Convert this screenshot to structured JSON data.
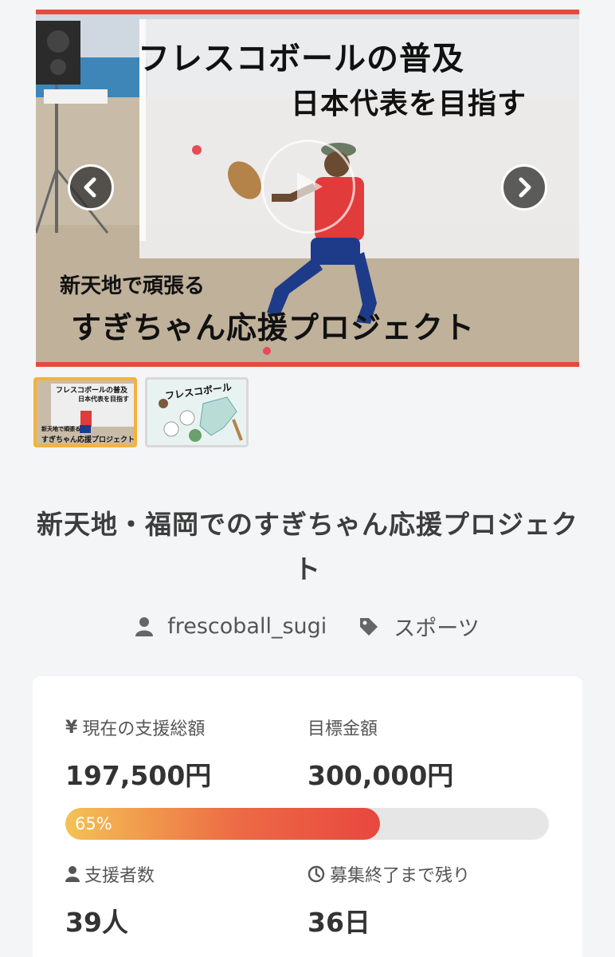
{
  "carousel": {
    "slide": {
      "line1": "フレスコボールの普及",
      "line2": "日本代表を目指す",
      "line3": "新天地で頑張る",
      "line4": "すぎちゃん応援プロジェクト"
    },
    "prev_icon": "chevron-left-icon",
    "next_icon": "chevron-right-icon",
    "play_icon": "play-icon",
    "active_index": 0,
    "thumbnails": [
      {
        "line1": "フレスコボールの普及",
        "line2": "日本代表を目指す",
        "line3": "新天地で頑張る",
        "line4": "すぎちゃん応援プロジェクト"
      },
      {
        "heading": "フレスコボール"
      }
    ]
  },
  "project": {
    "title": "新天地・福岡でのすぎちゃん応援プロジェクト",
    "author": "frescoball_sugi",
    "author_icon": "user-icon",
    "category": "スポーツ",
    "category_icon": "tag-icon"
  },
  "stats": {
    "current_label": "現在の支援総額",
    "current_icon": "yen-icon",
    "current_value": "197,500円",
    "target_label": "目標金額",
    "target_value": "300,000円",
    "progress_percent": 65,
    "progress_label": "65%",
    "supporters_label": "支援者数",
    "supporters_icon": "user-icon",
    "supporters_value": "39人",
    "remaining_label": "募集終了まで残り",
    "remaining_icon": "clock-icon",
    "remaining_value": "36日"
  },
  "colors": {
    "accent_red": "#e64a3c",
    "highlight_orange": "#f5a05c",
    "progress_start": "#f4c254",
    "progress_end": "#e8473f",
    "thumb_active_border": "#f4b23c"
  }
}
